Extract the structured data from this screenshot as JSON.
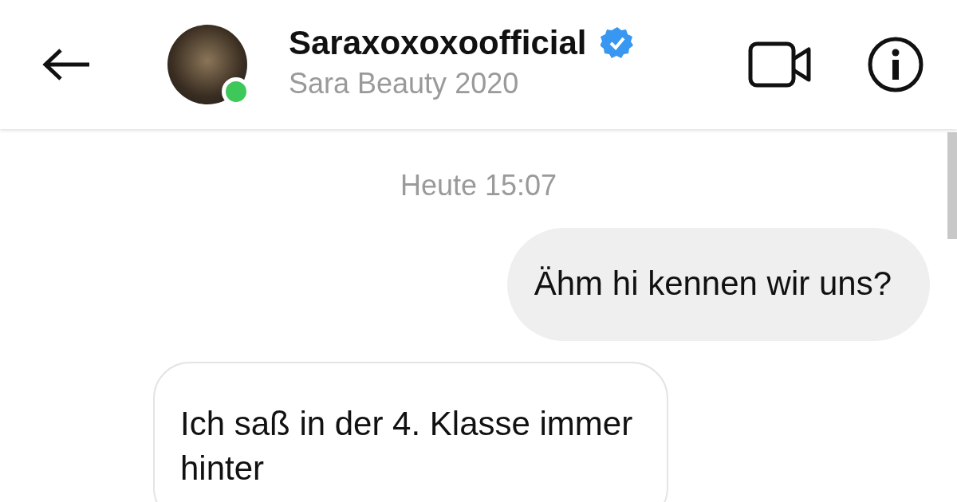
{
  "header": {
    "title": "Saraxoxoxoofficial",
    "verified": true,
    "online": true,
    "subtitle": "Sara Beauty 2020"
  },
  "timestamp": "Heute 15:07",
  "messages": [
    {
      "kind": "sent",
      "text": "Ähm hi kennen wir uns?"
    },
    {
      "kind": "received",
      "text": "Ich saß in der 4. Klasse immer hinter"
    }
  ]
}
